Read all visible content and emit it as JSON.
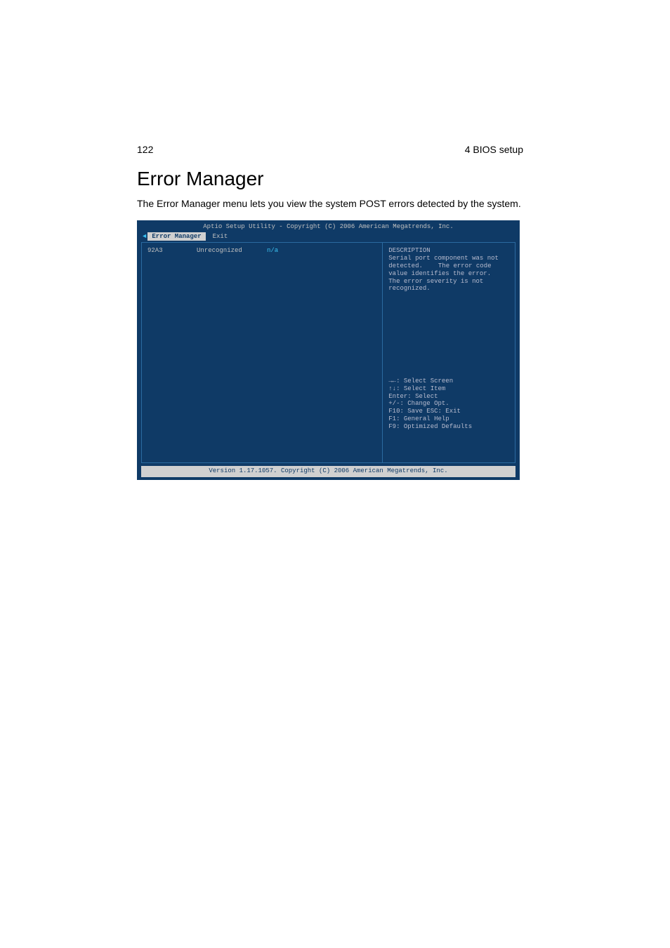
{
  "header": {
    "page_number": "122",
    "section": "4 BIOS setup"
  },
  "title": "Error Manager",
  "body_text": "The Error Manager menu lets you view the system POST errors detected by the system.",
  "bios": {
    "top_title": "Aptio Setup Utility - Copyright (C) 2006 American Megatrends, Inc.",
    "tabs": {
      "arrow": "◄",
      "active": "Error Manager",
      "other": "Exit"
    },
    "row": {
      "code": "92A3",
      "status": "Unrecognized",
      "value": "n/a"
    },
    "description": {
      "heading": "DESCRIPTION",
      "line1": "Serial port component was not",
      "line2a": "detected.",
      "line2b": "The error code",
      "line3": "value identifies the error.",
      "line4": "The error severity is not",
      "line5": "recognized."
    },
    "help": {
      "l1": "→←: Select Screen",
      "l2": "↑↓: Select Item",
      "l3": "Enter: Select",
      "l4": "+/-: Change Opt.",
      "l5": "F10: Save  ESC: Exit",
      "l6": "F1: General Help",
      "l7": "F9: Optimized Defaults"
    },
    "footer": "Version 1.17.1057. Copyright (C) 2006 American Megatrends, Inc."
  }
}
